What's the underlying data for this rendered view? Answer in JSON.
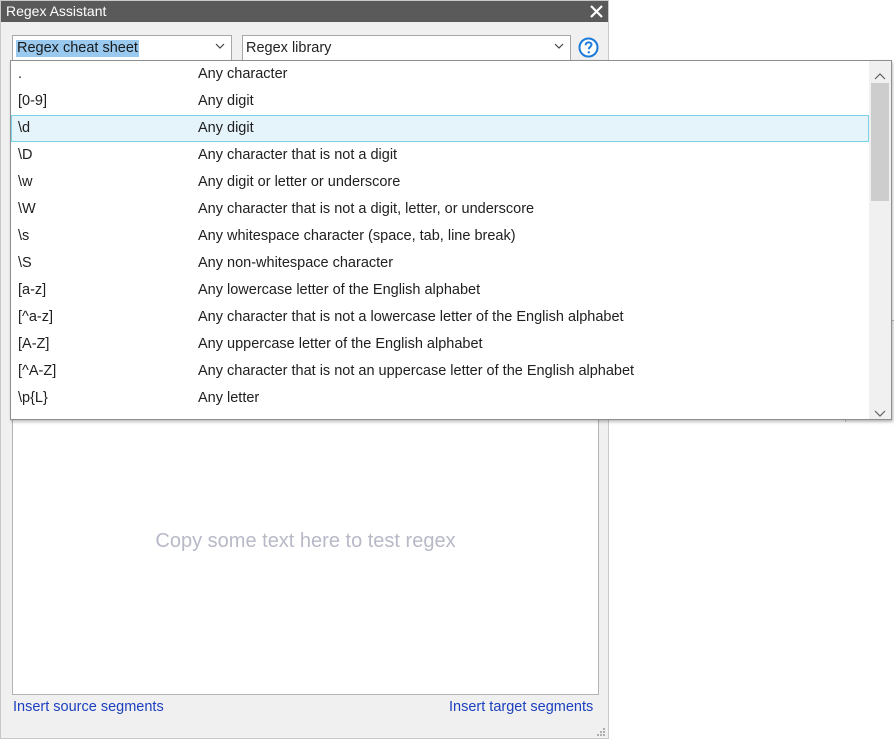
{
  "window": {
    "title": "Regex Assistant"
  },
  "toolbar": {
    "cheat_sheet_value": "Regex cheat sheet",
    "library_value": "Regex library"
  },
  "cheat_sheet": [
    {
      "pattern": ".",
      "description": "Any character"
    },
    {
      "pattern": "[0-9]",
      "description": "Any digit"
    },
    {
      "pattern": "\\d",
      "description": "Any digit"
    },
    {
      "pattern": "\\D",
      "description": "Any character that is not a digit"
    },
    {
      "pattern": "\\w",
      "description": "Any digit or letter or underscore"
    },
    {
      "pattern": "\\W",
      "description": "Any character that is not a digit, letter, or underscore"
    },
    {
      "pattern": "\\s",
      "description": "Any whitespace character (space, tab, line break)"
    },
    {
      "pattern": "\\S",
      "description": "Any non-whitespace character"
    },
    {
      "pattern": "[a-z]",
      "description": "Any lowercase letter of the English alphabet"
    },
    {
      "pattern": "[^a-z]",
      "description": "Any character that is not a lowercase letter of the English alphabet"
    },
    {
      "pattern": "[A-Z]",
      "description": "Any uppercase letter of the English alphabet"
    },
    {
      "pattern": "[^A-Z]",
      "description": "Any character that is not an uppercase letter of the English alphabet"
    },
    {
      "pattern": "\\p{L}",
      "description": "Any letter"
    }
  ],
  "selected_index": 2,
  "test_area": {
    "placeholder": "Copy some text here to test regex"
  },
  "links": {
    "insert_source": "Insert source segments",
    "insert_target": "Insert target segments"
  },
  "icons": {
    "close": "close-icon",
    "dropdown": "chevron-down-icon",
    "help": "help-icon",
    "scroll_up": "chevron-up-icon",
    "scroll_down": "chevron-down-icon"
  },
  "colors": {
    "title_bar": "#5a5a5a",
    "selection_highlight": "#99c9ef",
    "row_selected_bg": "#e5f3fb",
    "row_selected_border": "#7ad3e6",
    "help_blue": "#1c7ad8",
    "link_blue": "#1c3fbf",
    "placeholder_gray": "#b7b9c7"
  }
}
